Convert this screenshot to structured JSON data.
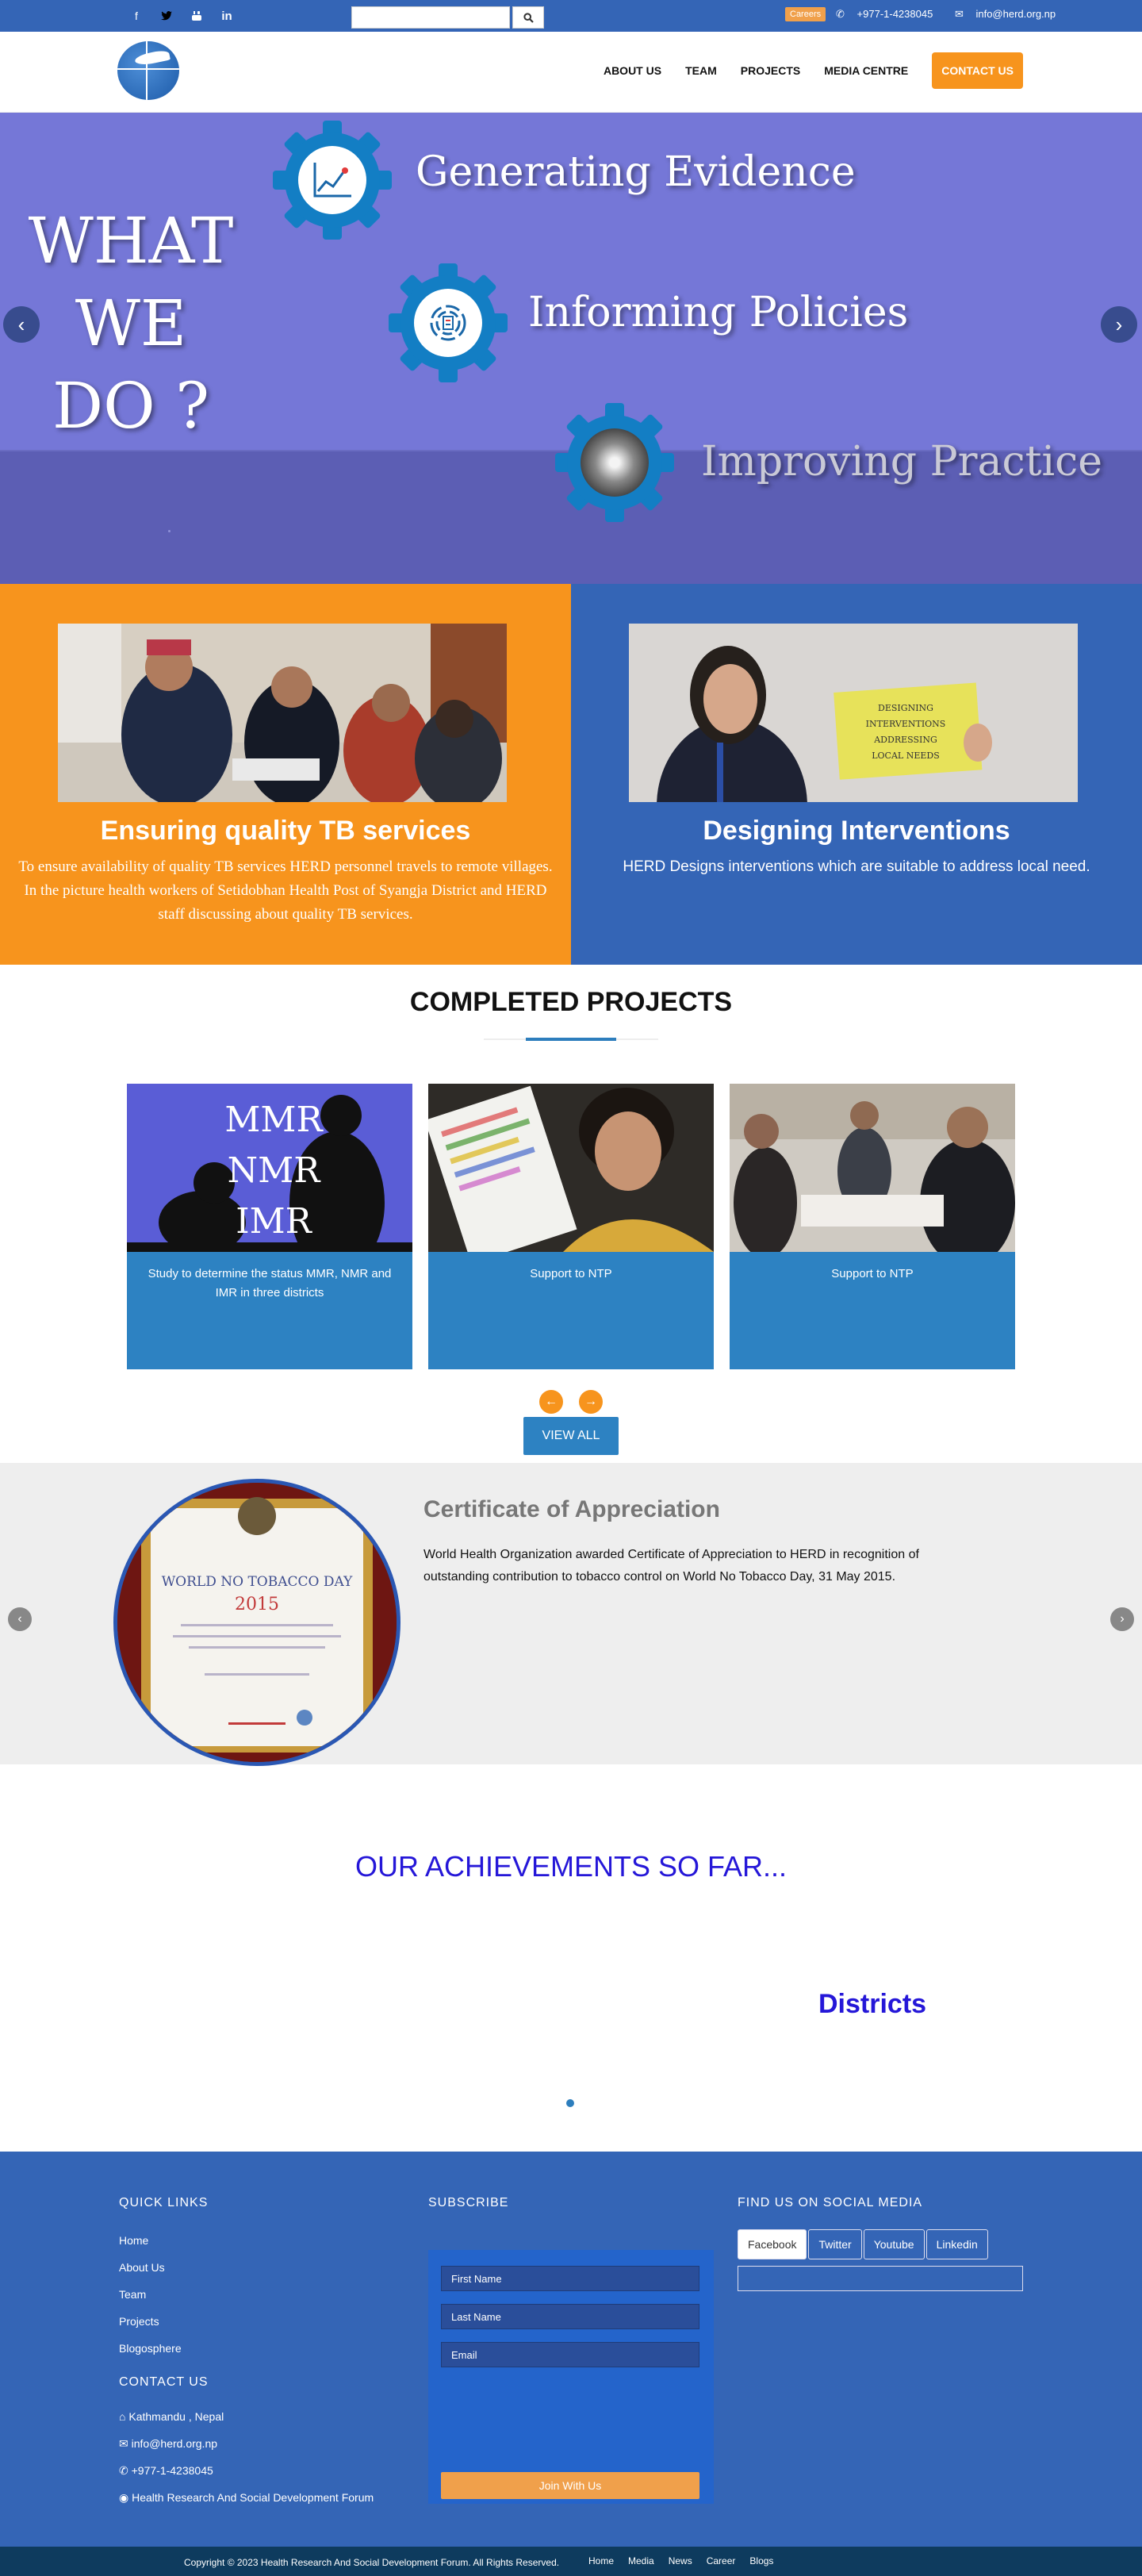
{
  "topbar": {
    "social_icons": [
      "facebook-icon",
      "twitter-icon",
      "youtube-icon",
      "linkedin-icon"
    ],
    "search_placeholder": "",
    "careers_label": "Careers",
    "phone": "+977-1-4238045",
    "email": "info@herd.org.np"
  },
  "nav": {
    "items": [
      "ABOUT US",
      "TEAM",
      "PROJECTS",
      "MEDIA CENTRE"
    ],
    "contact_label": "CONTACT US"
  },
  "hero": {
    "title_lines": [
      "WHAT",
      "WE",
      "DO ?"
    ],
    "items": [
      "Generating Evidence",
      "Informing Policies",
      "Improving Practice"
    ],
    "prev": "‹",
    "next": "›"
  },
  "features": [
    {
      "title": "Ensuring quality TB services",
      "text": "To ensure availability of quality TB services HERD personnel travels to remote villages. In the picture health workers of Setidobhan Health Post of Syangja District and HERD staff discussing about quality TB services."
    },
    {
      "title": "Designing Interventions",
      "text": "HERD Designs interventions which are suitable to address local need.",
      "sign_text": [
        "DESIGNING",
        "INTERVENTIONS",
        "ADDRESSING",
        "LOCAL NEEDS"
      ]
    }
  ],
  "completed": {
    "title": "COMPLETED PROJECTS",
    "cards": [
      {
        "caption": "Study to determine the status MMR, NMR and IMR in three districts",
        "img_text": [
          "MMR",
          "NMR",
          "IMR"
        ]
      },
      {
        "caption": "Support to NTP"
      },
      {
        "caption": "Support to NTP"
      }
    ],
    "prev": "←",
    "next": "→",
    "view_all": "VIEW ALL"
  },
  "certificate": {
    "title": "Certificate of Appreciation",
    "text": "World Health Organization awarded Certificate of Appreciation to HERD in recognition of outstanding contribution to tobacco control on World No Tobacco Day, 31 May 2015.",
    "img_heading": "WORLD NO TOBACCO DAY",
    "img_year": "2015",
    "prev": "‹",
    "next": "›"
  },
  "achievements": {
    "title": "OUR ACHIEVEMENTS SO FAR...",
    "label": "Districts"
  },
  "footer": {
    "quick_links_title": "QUICK LINKS",
    "quick_links": [
      "Home",
      "About Us",
      "Team",
      "Projects",
      "Blogosphere"
    ],
    "contact_title": "CONTACT US",
    "contact": [
      {
        "icon": "home-icon",
        "text": "Kathmandu , Nepal"
      },
      {
        "icon": "envelope-icon",
        "text": "info@herd.org.np"
      },
      {
        "icon": "phone-icon",
        "text": "+977-1-4238045"
      },
      {
        "icon": "globe-icon",
        "text": "Health Research And Social Development Forum"
      }
    ],
    "subscribe_title": "SUBSCRIBE",
    "first_name": "First Name",
    "last_name": "Last Name",
    "email": "Email",
    "join": "Join With Us",
    "social_title": "FIND US ON SOCIAL MEDIA",
    "social_tabs": [
      "Facebook",
      "Twitter",
      "Youtube",
      "Linkedin"
    ],
    "copyright": "Copyright © 2023 Health Research And Social Development Forum. All Rights Reserved.",
    "bottom_links": [
      "Home",
      "Media",
      "News",
      "Career",
      "Blogs"
    ]
  },
  "colors": {
    "brand_blue": "#3465b6",
    "accent_orange": "#f7941d",
    "card_blue": "#2d82c2",
    "achievement_blue": "#2517d8"
  }
}
